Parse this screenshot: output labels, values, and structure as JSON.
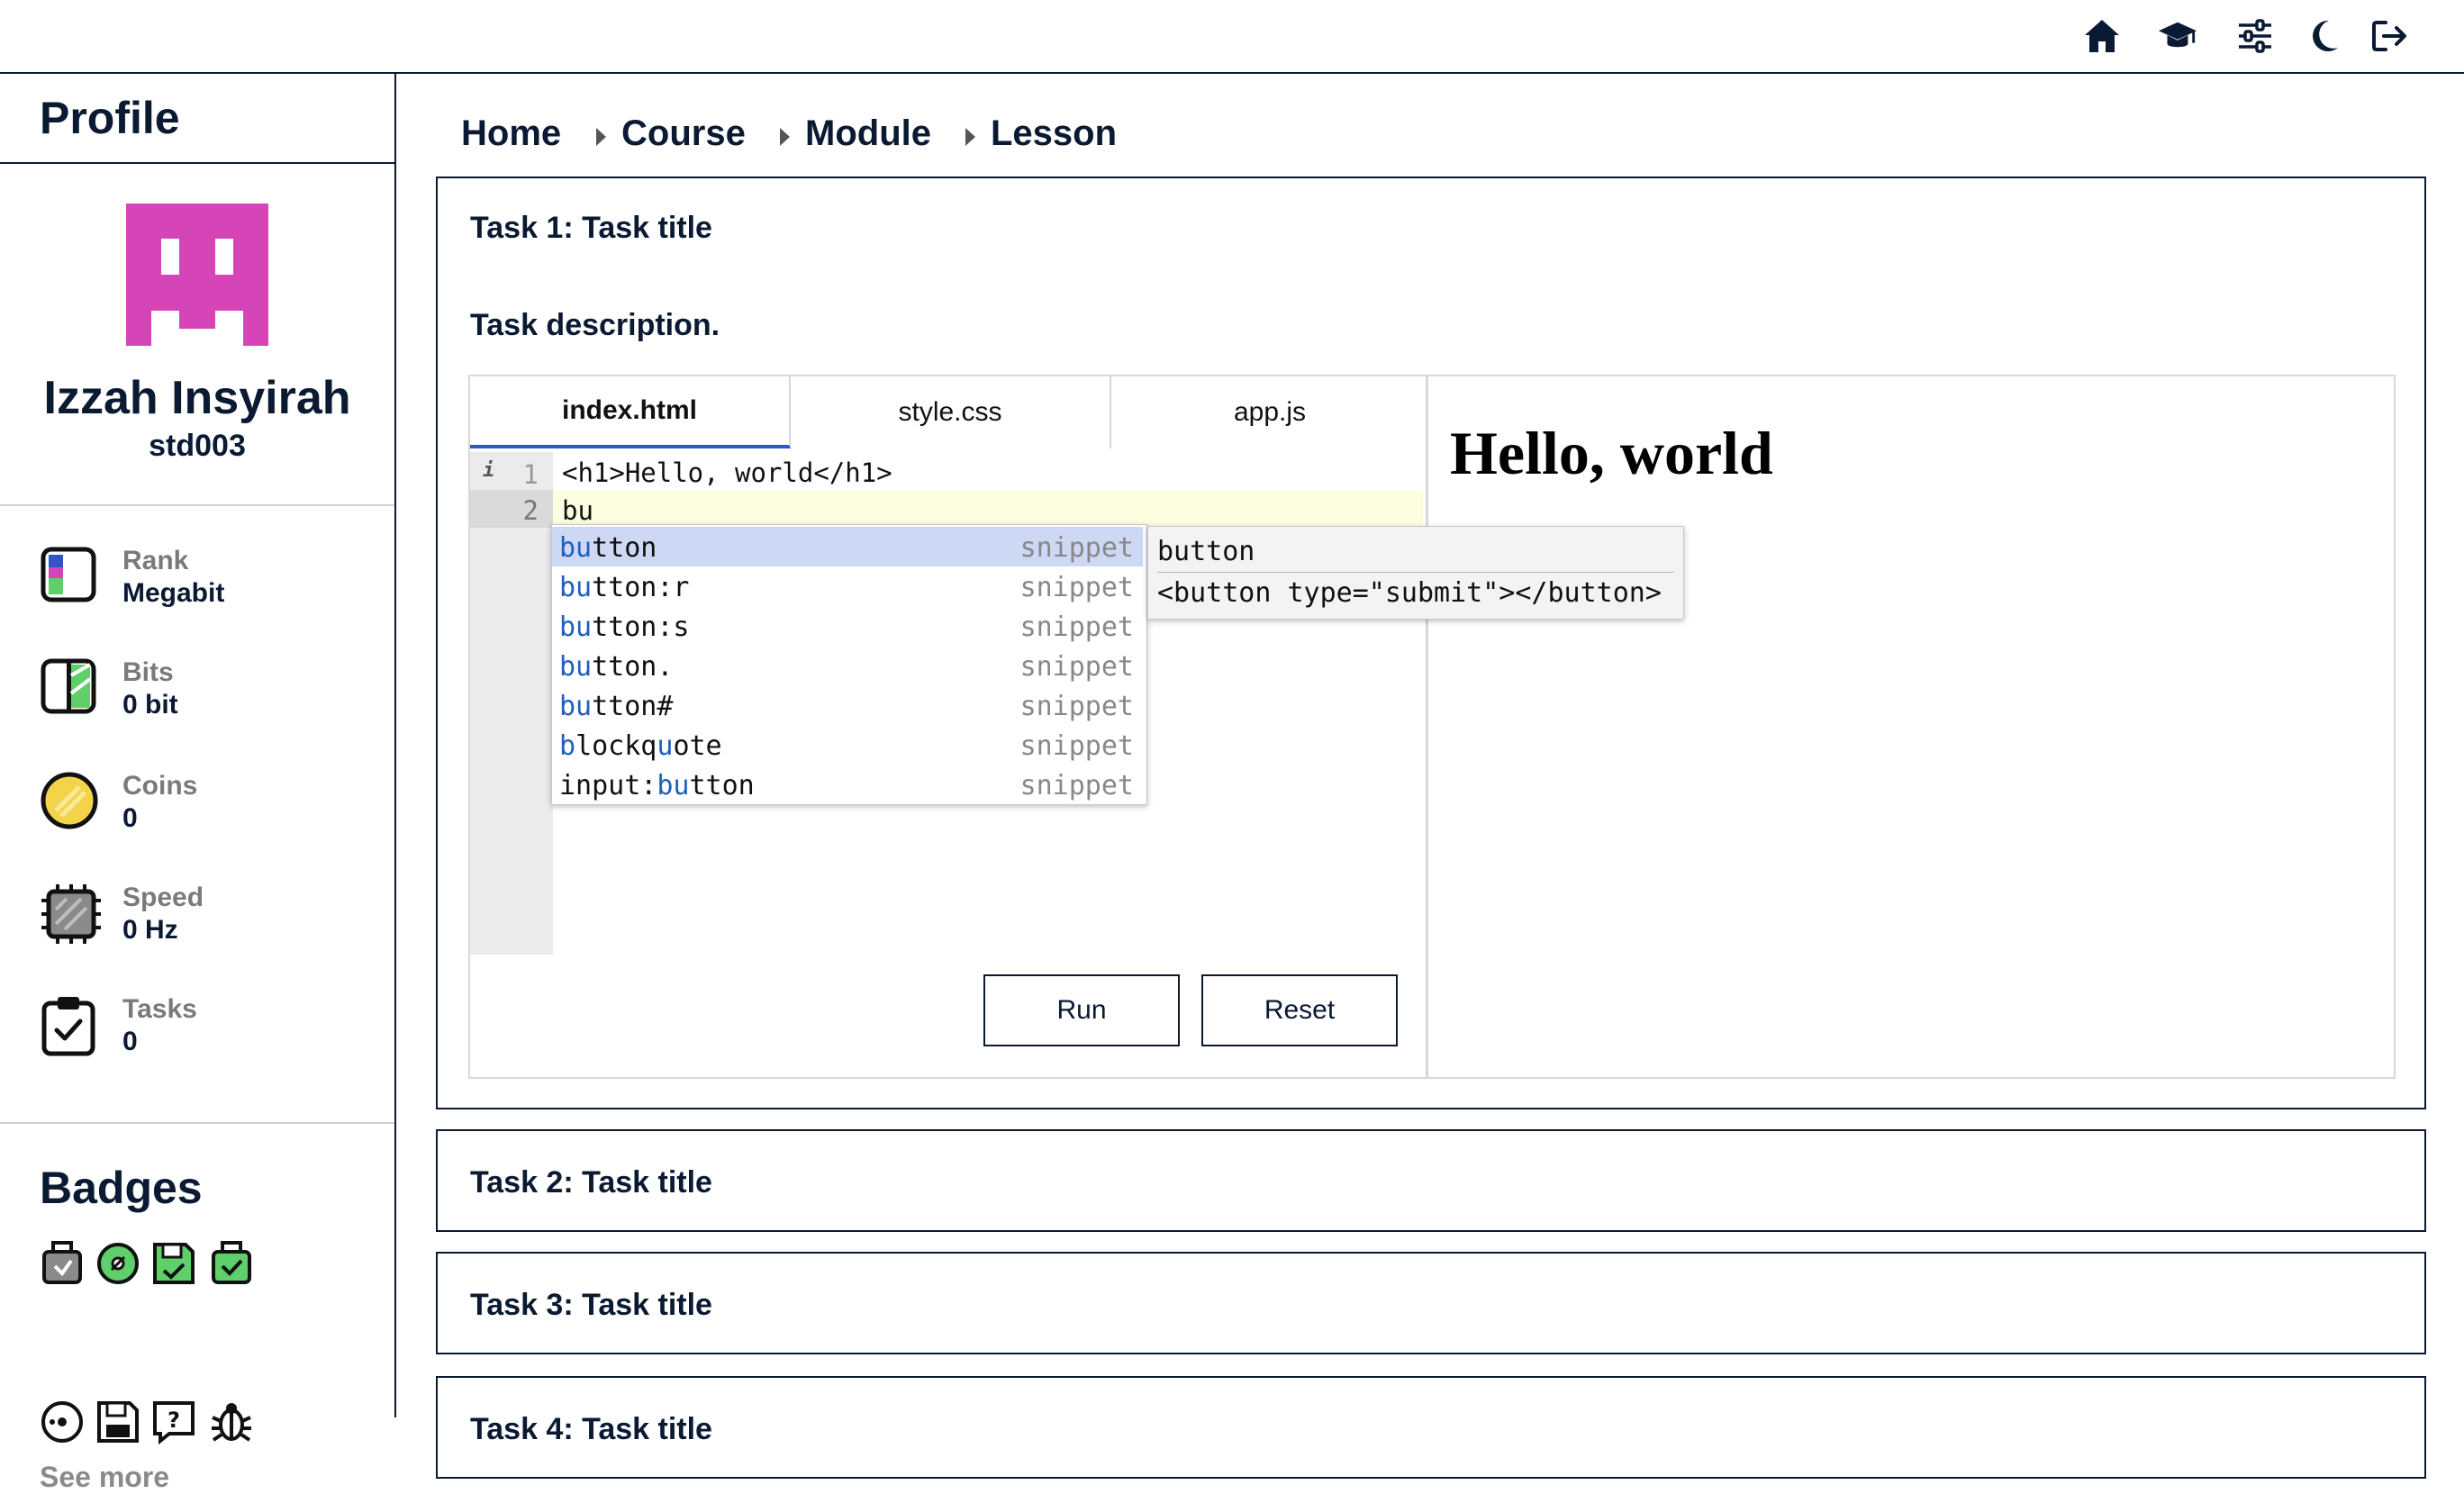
{
  "topbar": {
    "icons": [
      "home-icon",
      "graduation-cap-icon",
      "sliders-icon",
      "moon-icon",
      "logout-icon"
    ]
  },
  "sidebar": {
    "profile_heading": "Profile",
    "user_name": "Izzah Insyirah",
    "user_id": "std003",
    "stats": [
      {
        "label": "Rank",
        "value": "Megabit",
        "icon": "rank-icon"
      },
      {
        "label": "Bits",
        "value": "0 bit",
        "icon": "bits-icon"
      },
      {
        "label": "Coins",
        "value": "0",
        "icon": "coin-icon"
      },
      {
        "label": "Speed",
        "value": "0 Hz",
        "icon": "cpu-chip-icon"
      },
      {
        "label": "Tasks",
        "value": "0",
        "icon": "clipboard-check-icon"
      }
    ],
    "badges_heading": "Badges",
    "see_more": "See more"
  },
  "breadcrumb": [
    "Home",
    "Course",
    "Module",
    "Lesson"
  ],
  "tasks": [
    {
      "title": "Task 1: Task title",
      "description": "Task description."
    },
    {
      "title": "Task 2: Task title"
    },
    {
      "title": "Task 3: Task title"
    },
    {
      "title": "Task 4: Task title"
    }
  ],
  "editor": {
    "tabs": [
      "index.html",
      "style.css",
      "app.js"
    ],
    "active_tab": "index.html",
    "line_numbers": [
      "1",
      "2"
    ],
    "lines": [
      "<h1>Hello, world</h1>",
      "bu"
    ],
    "autocomplete": [
      {
        "pre": "",
        "m1": "bu",
        "post": "tton",
        "kind": "snippet"
      },
      {
        "pre": "",
        "m1": "bu",
        "post": "tton:r",
        "kind": "snippet"
      },
      {
        "pre": "",
        "m1": "bu",
        "post": "tton:s",
        "kind": "snippet"
      },
      {
        "pre": "",
        "m1": "bu",
        "post": "tton.",
        "kind": "snippet"
      },
      {
        "pre": "",
        "m1": "bu",
        "post": "tton#",
        "kind": "snippet"
      },
      {
        "pre": "",
        "m1": "b",
        "mid": "lockq",
        "m2": "u",
        "post": "ote",
        "kind": "snippet"
      },
      {
        "pre": "input:",
        "m1": "bu",
        "post": "tton",
        "kind": "snippet"
      }
    ],
    "tooltip_title": "button",
    "tooltip_body": "<button type=\"submit\"></button>",
    "run_label": "Run",
    "reset_label": "Reset"
  },
  "preview": {
    "heading": "Hello, world"
  },
  "colors": {
    "navy": "#0b1a33",
    "accent_blue": "#2f56c9",
    "avatar_magenta": "#d545b8",
    "current_line": "#fdfde0",
    "selected_suggestion": "#cdd8f5"
  }
}
